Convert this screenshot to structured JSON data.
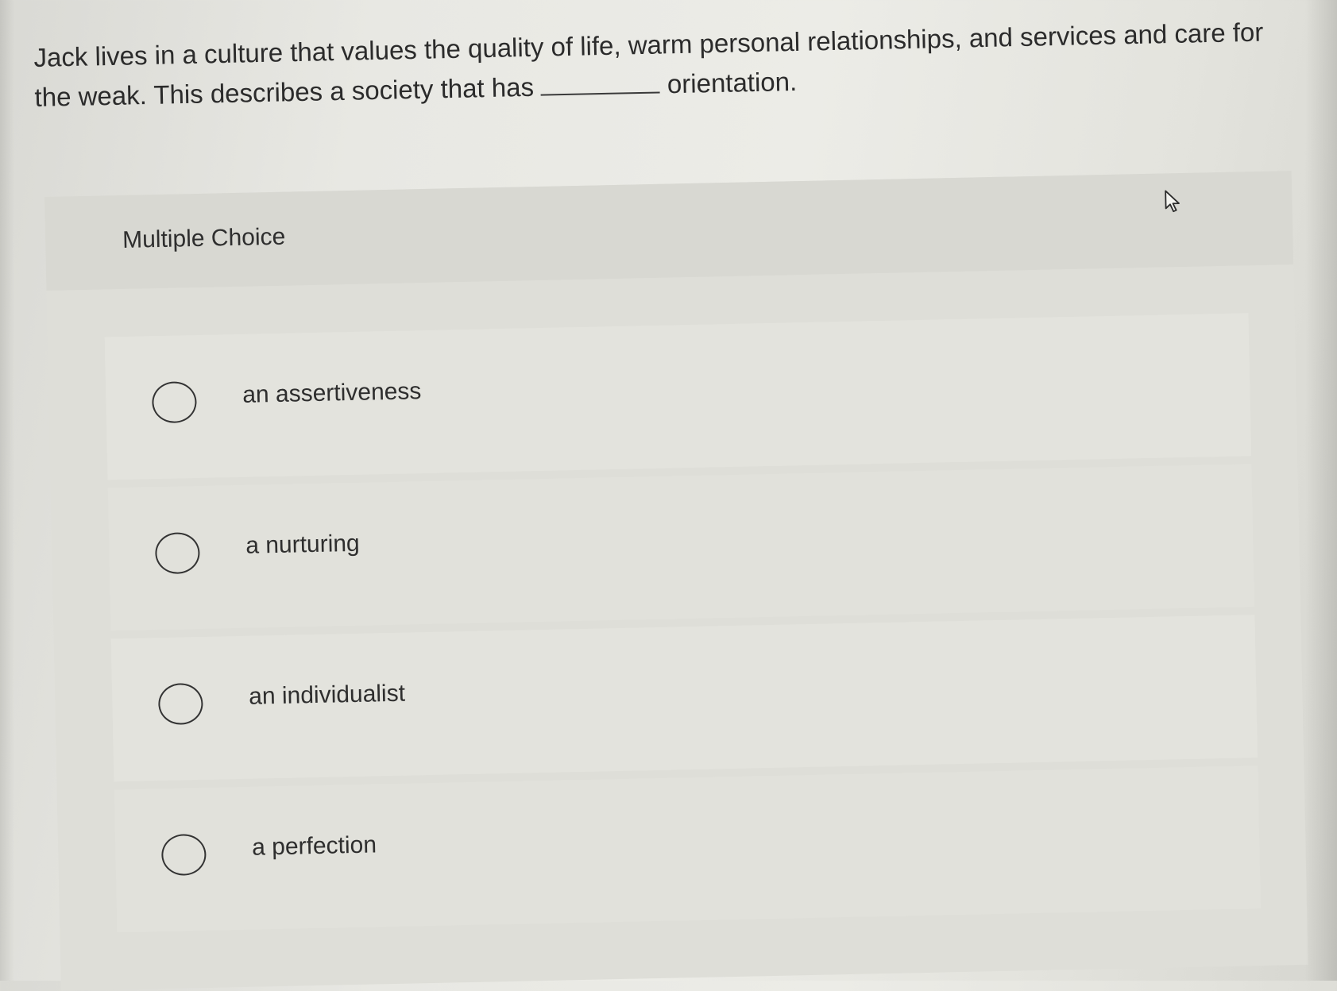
{
  "question": {
    "text_before_blank": "Jack lives in a culture that values the quality of life, warm personal relationships, and services and care for the weak. This describes a society that has",
    "text_after_blank": "orientation."
  },
  "panel": {
    "title": "Multiple Choice",
    "cursor_icon": "mouse-pointer-icon"
  },
  "options": [
    {
      "label": "an assertiveness",
      "selected": false
    },
    {
      "label": "a nurturing",
      "selected": false
    },
    {
      "label": "an individualist",
      "selected": false
    },
    {
      "label": "a perfection",
      "selected": false
    }
  ],
  "colors": {
    "text": "#2e2e2e",
    "panel_bg": "#deded8",
    "radio_border": "#333333"
  }
}
